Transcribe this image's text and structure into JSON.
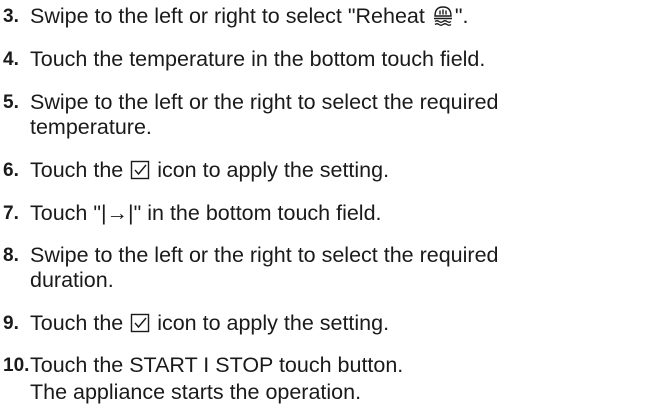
{
  "steps": [
    {
      "num": "3.",
      "before": "Swipe to the left or right to select \"Reheat ",
      "after": "\"."
    },
    {
      "num": "4.",
      "text": "Touch the temperature in the bottom touch field."
    },
    {
      "num": "5.",
      "line1": "Swipe to the left or the right to select the required",
      "line2": "temperature."
    },
    {
      "num": "6.",
      "before": "Touch the ",
      "after": " icon to apply the setting."
    },
    {
      "num": "7.",
      "text": "Touch \"|→|\" in the bottom touch field."
    },
    {
      "num": "8.",
      "line1": "Swipe to the left or the right to select the required",
      "line2": "duration."
    },
    {
      "num": "9.",
      "before": "Touch the ",
      "after": " icon to apply the setting."
    },
    {
      "num": "10.",
      "text": "Touch the START I STOP touch button."
    }
  ],
  "result": "The appliance starts the operation.",
  "icons": {
    "reheat": "reheat-icon",
    "confirm": "checkbox-check-icon"
  }
}
